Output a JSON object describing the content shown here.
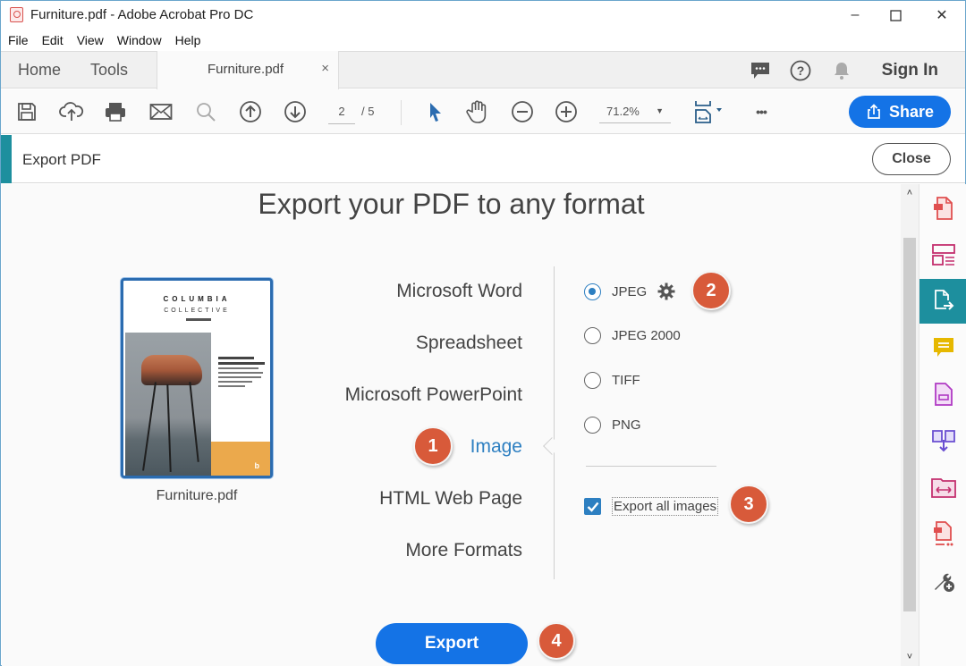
{
  "window": {
    "title": "Furniture.pdf - Adobe Acrobat Pro DC",
    "minimize_label": "–",
    "maximize_label": "☐",
    "close_label": "✕"
  },
  "menu": [
    "File",
    "Edit",
    "View",
    "Window",
    "Help"
  ],
  "tabs": {
    "home": "Home",
    "tools": "Tools",
    "document": "Furniture.pdf",
    "document_close": "×",
    "sign_in": "Sign In"
  },
  "toolbar": {
    "current_page": "2",
    "page_total": "/ 5",
    "zoom_level": "71.2%",
    "zoom_caret": "▼",
    "share_label": "Share",
    "more_label": "•••"
  },
  "export_panel": {
    "header_title": "Export PDF",
    "close_label": "Close",
    "main_title": "Export your PDF to any format",
    "thumbnail": {
      "caption": "Furniture.pdf",
      "logo_line1": "COLUMBIA",
      "logo_line2": "COLLECTIVE",
      "corner_mark": "b"
    },
    "formats": [
      {
        "label": "Microsoft Word",
        "active": false
      },
      {
        "label": "Spreadsheet",
        "active": false
      },
      {
        "label": "Microsoft PowerPoint",
        "active": false
      },
      {
        "label": "Image",
        "active": true
      },
      {
        "label": "HTML Web Page",
        "active": false
      },
      {
        "label": "More Formats",
        "active": false
      }
    ],
    "image_options": [
      {
        "label": "JPEG",
        "selected": true
      },
      {
        "label": "JPEG 2000",
        "selected": false
      },
      {
        "label": "TIFF",
        "selected": false
      },
      {
        "label": "PNG",
        "selected": false
      }
    ],
    "export_all_images": {
      "label": "Export all images",
      "checked": true
    },
    "export_label": "Export"
  },
  "badges": [
    "1",
    "2",
    "3",
    "4"
  ],
  "scrollbar": {
    "up": "˄",
    "down": "˅"
  },
  "right_rail": [
    {
      "icon": "create-pdf-icon",
      "color": "#e04f4f",
      "active": false
    },
    {
      "icon": "organize-pages-icon",
      "color": "#c4306f",
      "active": false
    },
    {
      "icon": "export-pdf-icon",
      "color": "#ffffff",
      "active": true
    },
    {
      "icon": "comment-icon",
      "color": "#e6b800",
      "active": false
    },
    {
      "icon": "fill-sign-icon",
      "color": "#b03ac4",
      "active": false
    },
    {
      "icon": "compress-icon",
      "color": "#6a4fd1",
      "active": false
    },
    {
      "icon": "combine-icon",
      "color": "#c4306f",
      "active": false
    },
    {
      "icon": "redact-icon",
      "color": "#e04f4f",
      "active": false
    },
    {
      "icon": "more-tools-icon",
      "color": "#555555",
      "active": false
    }
  ],
  "colors": {
    "accent_blue": "#1473e6",
    "teal": "#1d8f9e",
    "badge": "#d85a3a",
    "active_link": "#2d7fc1"
  }
}
